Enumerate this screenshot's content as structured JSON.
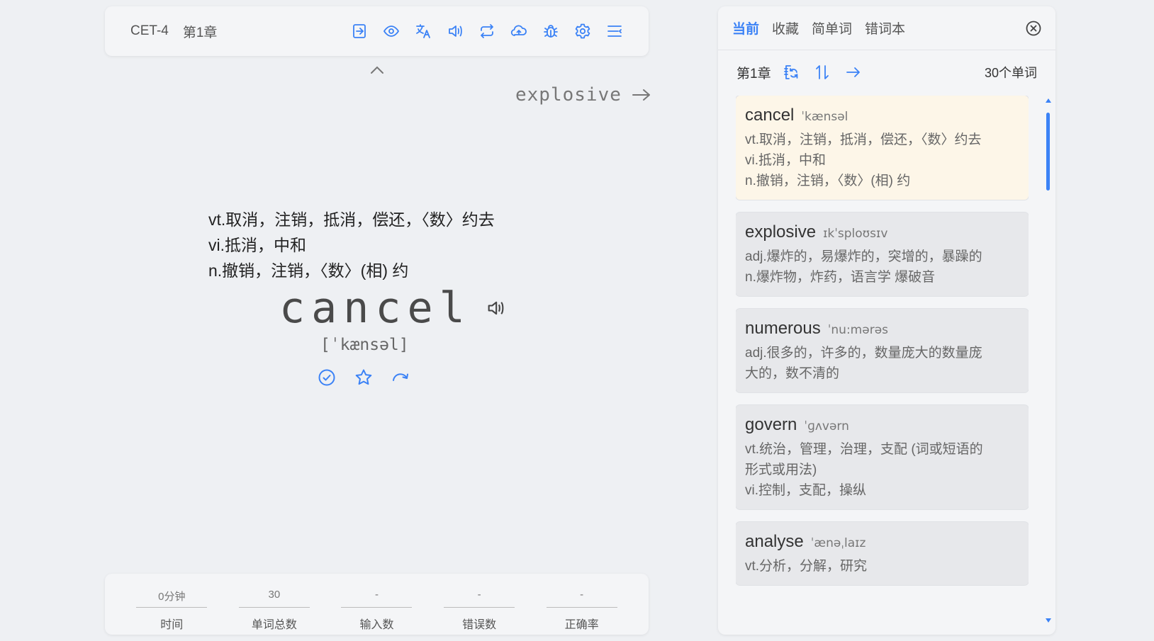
{
  "toolbar": {
    "dict": "CET-4",
    "chapter": "第1章",
    "icons": [
      "enter-icon",
      "eye-icon",
      "translate-icon",
      "speaker-icon",
      "repeat-icon",
      "cloud-upload-icon",
      "bug-icon",
      "gear-icon",
      "menu-icon"
    ]
  },
  "next_word": "explosive",
  "main": {
    "definitions": [
      "vt.取消，注销，抵消，偿还，〈数〉约去",
      "vi.抵消，中和",
      "n.撤销，注销，〈数〉(相) 约"
    ],
    "word": "cancel",
    "phonetic": "[ˈkænsəl]"
  },
  "stats": [
    {
      "value": "0分钟",
      "label": "时间"
    },
    {
      "value": "30",
      "label": "单词总数"
    },
    {
      "value": "-",
      "label": "输入数"
    },
    {
      "value": "-",
      "label": "错误数"
    },
    {
      "value": "-",
      "label": "正确率"
    }
  ],
  "panel": {
    "tabs": [
      "当前",
      "收藏",
      "简单词",
      "错词本"
    ],
    "chapter": "第1章",
    "count": "30个单词",
    "words": [
      {
        "word": "cancel",
        "phonetic": "ˈkænsəl",
        "defs": [
          "vt.取消，注销，抵消，偿还，〈数〉约去",
          "vi.抵消，中和",
          "n.撤销，注销，〈数〉(相) 约"
        ]
      },
      {
        "word": "explosive",
        "phonetic": "ɪkˈsploʊsɪv",
        "defs": [
          "adj.爆炸的，易爆炸的，突增的，暴躁的",
          "n.爆炸物，炸药，语言学 爆破音"
        ]
      },
      {
        "word": "numerous",
        "phonetic": "ˈnu:mərəs",
        "defs": [
          "adj.很多的，许多的，数量庞大的数量庞大的，数不清的"
        ]
      },
      {
        "word": "govern",
        "phonetic": "ˈɡʌvərn",
        "defs": [
          "vt.统治，管理，治理，支配 (词或短语的形式或用法)",
          "vi.控制，支配，操纵"
        ]
      },
      {
        "word": "analyse",
        "phonetic": "ˈænəˌlaɪz",
        "defs": [
          "vt.分析，分解，研究"
        ]
      }
    ]
  }
}
